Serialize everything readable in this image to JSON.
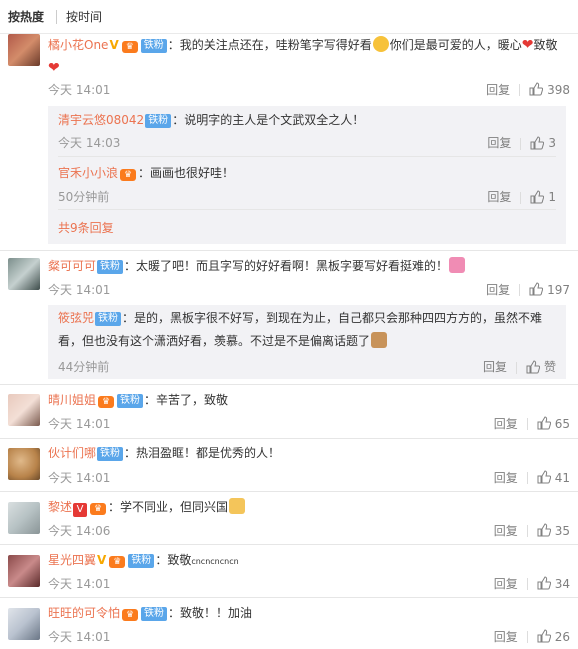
{
  "tabs": {
    "hot": "按热度",
    "time": "按时间"
  },
  "labels": {
    "reply": "回复",
    "more": "共9条回复",
    "tiefen": "铁粉",
    "like_text": "赞"
  },
  "comments": [
    {
      "user": "橘小花One",
      "text": "：我的关注点还在，哇粉笔字写得好看",
      "text2": "你们是最可爱的人，暖心",
      "text3": "致敬",
      "time": "今天 14:01",
      "likes": "398"
    },
    {
      "user": "粲可可可",
      "text": "：太暖了吧！而且字写的好好看啊！黑板字要写好看挺难的！",
      "time": "今天 14:01",
      "likes": "197"
    },
    {
      "user": "晴川姐姐",
      "text": "：辛苦了，致敬",
      "time": "今天 14:01",
      "likes": "65"
    },
    {
      "user": "伙计们哪",
      "text": "：热泪盈眶！都是优秀的人！",
      "time": "今天 14:01",
      "likes": "41"
    },
    {
      "user": "黎述",
      "text": "：学不同业，但同兴国",
      "time": "今天 14:06",
      "likes": "35"
    },
    {
      "user": "星光四翼",
      "text": "：致敬",
      "text_small": "cncncncncn",
      "time": "今天 14:01",
      "likes": "34"
    },
    {
      "user": "旺旺的可令怕",
      "text": "：致敬！！加油",
      "time": "今天 14:01",
      "likes": "26"
    }
  ],
  "subs1": [
    {
      "user": "清宇云悠08042",
      "text": "：说明字的主人是个文武双全之人！",
      "time": "今天 14:03",
      "likes": "3"
    },
    {
      "user": "官禾小小浪",
      "text": "：画画也很好哇！",
      "time": "50分钟前",
      "likes": "1"
    }
  ],
  "subs2": [
    {
      "user": "筱弦兕",
      "text": "：是的，黑板字很不好写，到现在为止，自己都只会那种四四方方的，虽然不难",
      "text2": "看，但也没有这个潇洒好看，羡慕。不过是不是偏离话题了",
      "time": "44分钟前"
    }
  ],
  "colors": {
    "name": "#eb7350",
    "badge": "#5aa6ea",
    "bg_sub": "#f2f2f5"
  }
}
